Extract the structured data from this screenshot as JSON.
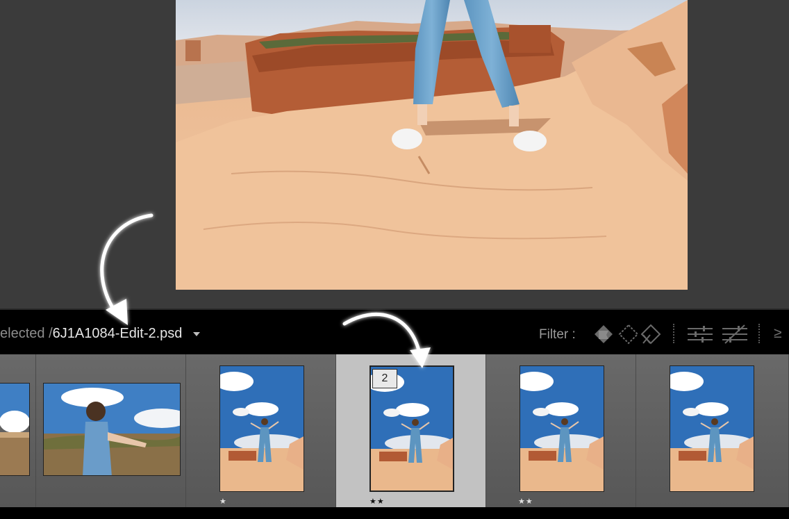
{
  "header": {
    "selected_label": "elected",
    "separator": "/",
    "filename": "6J1A1084-Edit-2.psd",
    "filter_label": "Filter :",
    "more_glyph": "≥"
  },
  "filmstrip": {
    "items": [
      {
        "stars": ""
      },
      {
        "stars": ""
      },
      {
        "stars": "★"
      },
      {
        "stars": "★★",
        "selected": true,
        "badge": "2"
      },
      {
        "stars": "★★"
      },
      {
        "stars": ""
      }
    ]
  },
  "icons": [
    "filter-flag-icon",
    "filter-unflagged-icon",
    "filter-rejected-icon",
    "filter-sliders-icon",
    "filter-sliders-off-icon",
    "more-icon",
    "dropdown-caret-icon"
  ],
  "colors": {
    "header_bg": "#000000",
    "selected_cell": "#c2c2c2",
    "filmstrip_bg": "#626262"
  }
}
